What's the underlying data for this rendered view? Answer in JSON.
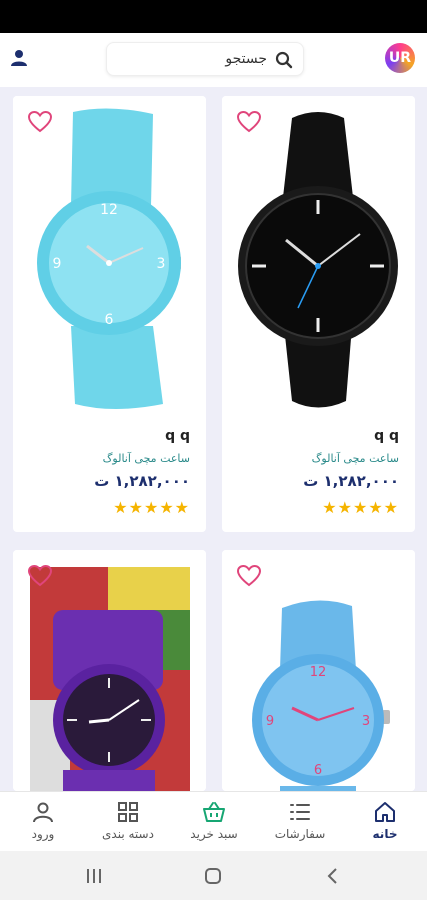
{
  "header": {
    "search_placeholder": "جستجو",
    "logo_text": "UR"
  },
  "products": [
    {
      "brand": "q q",
      "name": "ساعت مچی آنالوگ",
      "price": "۱,۲۸۲,۰۰۰ ت",
      "rating": 5,
      "image": "black-watch"
    },
    {
      "brand": "q q",
      "name": "ساعت مچی آنالوگ",
      "price": "۱,۲۸۲,۰۰۰ ت",
      "rating": 5,
      "image": "light-blue-watch"
    },
    {
      "brand": "",
      "name": "",
      "price": "",
      "rating": 0,
      "image": "blue-watch-pink-numbers"
    },
    {
      "brand": "",
      "name": "",
      "price": "",
      "rating": 0,
      "image": "purple-watch"
    }
  ],
  "bottom_nav": {
    "home": "خانه",
    "orders": "سفارشات",
    "cart": "سبد خرید",
    "categories": "دسته بندی",
    "login": "ورود"
  },
  "colors": {
    "accent": "#1d2f6e",
    "star": "#f5b400",
    "heart": "#e0457b",
    "cart": "#17a673"
  },
  "stars_text": "★★★★★"
}
